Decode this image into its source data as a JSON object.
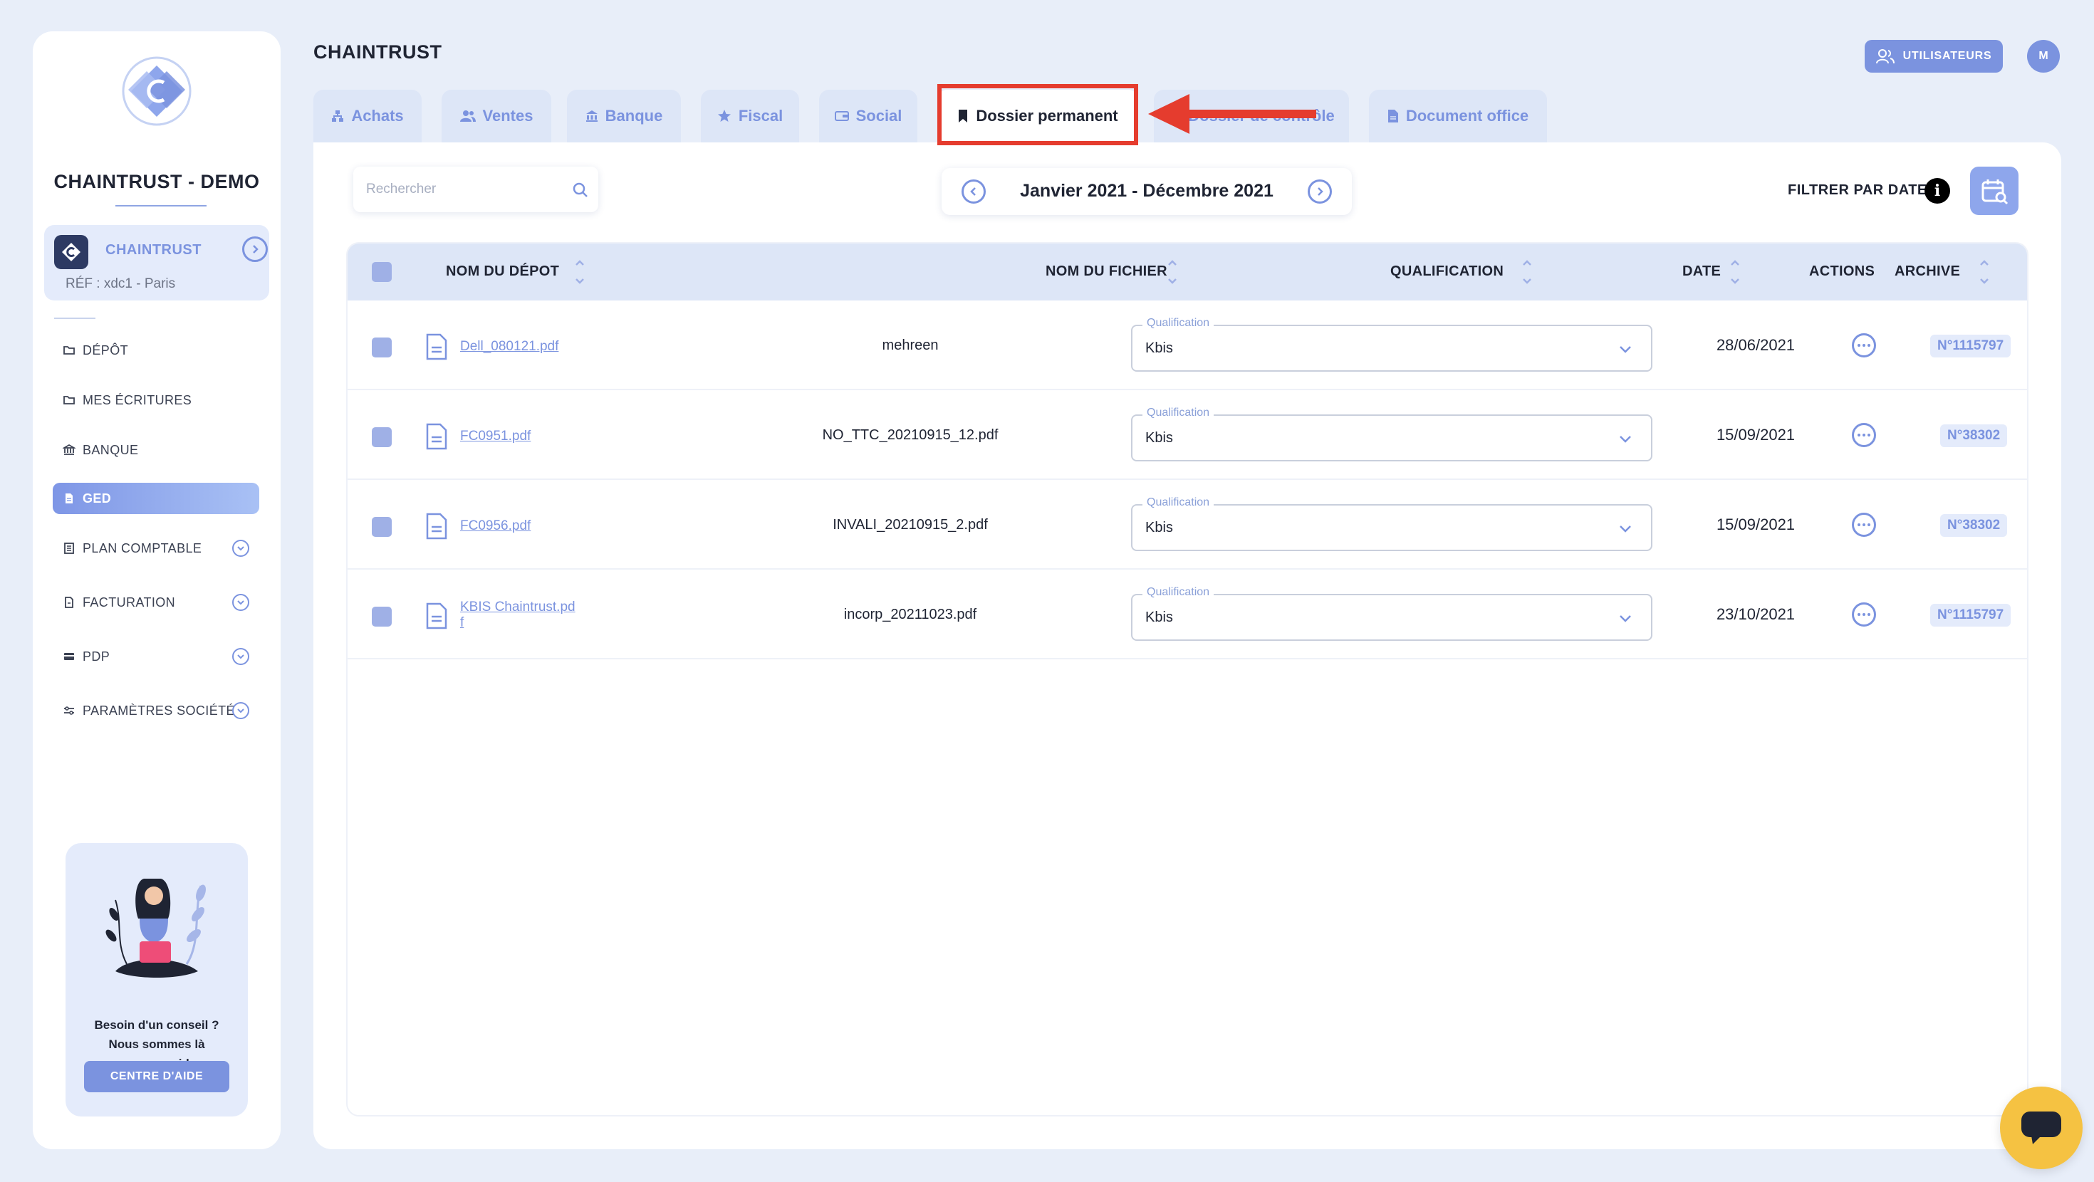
{
  "sidebar": {
    "company_name": "CHAINTRUST - DEMO",
    "org": {
      "name": "CHAINTRUST",
      "ref": "RÉF : xdc1 - Paris"
    },
    "items": [
      {
        "label": "DÉPÔT",
        "icon": "folder-sync-icon"
      },
      {
        "label": "MES ÉCRITURES",
        "icon": "folder-sync-icon"
      },
      {
        "label": "BANQUE",
        "icon": "bank-icon"
      },
      {
        "label": "GED",
        "icon": "document-icon",
        "active": true
      },
      {
        "label": "PLAN COMPTABLE",
        "icon": "ledger-icon",
        "expandable": true
      },
      {
        "label": "FACTURATION",
        "icon": "invoice-icon",
        "expandable": true
      },
      {
        "label": "PDP",
        "icon": "card-icon",
        "expandable": true
      },
      {
        "label": "PARAMÈTRES SOCIÉTÉ",
        "icon": "sliders-icon",
        "expandable": true
      }
    ],
    "help": {
      "line1": "Besoin d'un conseil ?",
      "line2": "Nous sommes là",
      "line3": "pour vous aider.",
      "button": "CENTRE D'AIDE"
    }
  },
  "header": {
    "title": "CHAINTRUST",
    "users_button": "UTILISATEURS",
    "avatar_initial": "M"
  },
  "tabs": [
    {
      "label": "Achats",
      "icon": "tree-icon"
    },
    {
      "label": "Ventes",
      "icon": "users-icon"
    },
    {
      "label": "Banque",
      "icon": "bank-icon"
    },
    {
      "label": "Fiscal",
      "icon": "star-icon"
    },
    {
      "label": "Social",
      "icon": "wallet-icon"
    },
    {
      "label": "Dossier permanent",
      "icon": "bookmark-icon",
      "active": true
    },
    {
      "label": "Dossier de contrôle",
      "icon": "check-icon"
    },
    {
      "label": "Document office",
      "icon": "file-icon"
    }
  ],
  "toolbar": {
    "search_placeholder": "Rechercher",
    "date_range": "Janvier 2021 - Décembre 2021",
    "filter_label": "FILTRER PAR DATE",
    "info_glyph": "i"
  },
  "table": {
    "columns": {
      "deposit": "NOM DU DÉPOT",
      "file": "NOM DU FICHIER",
      "qualification": "QUALIFICATION",
      "date": "DATE",
      "actions": "ACTIONS",
      "archive": "ARCHIVE"
    },
    "qualification_legend": "Qualification",
    "rows": [
      {
        "deposit_line1": "Dell_080121.pdf",
        "deposit_line2": "",
        "file": "mehreen",
        "qualification": "Kbis",
        "date": "28/06/2021",
        "archive": "N°1115797"
      },
      {
        "deposit_line1": "FC0951.pdf",
        "deposit_line2": "",
        "file": "NO_TTC_20210915_12.pdf",
        "qualification": "Kbis",
        "date": "15/09/2021",
        "archive": "N°38302"
      },
      {
        "deposit_line1": "FC0956.pdf",
        "deposit_line2": "",
        "file": "INVALI_20210915_2.pdf",
        "qualification": "Kbis",
        "date": "15/09/2021",
        "archive": "N°38302"
      },
      {
        "deposit_line1": "KBIS Chaintrust.pd",
        "deposit_line2": "f",
        "file": "incorp_20211023.pdf",
        "qualification": "Kbis",
        "date": "23/10/2021",
        "archive": "N°1115797"
      }
    ]
  },
  "colors": {
    "accent": "#7b93df",
    "annotation_red": "#e53c2e",
    "chat_yellow": "#f5c242"
  }
}
